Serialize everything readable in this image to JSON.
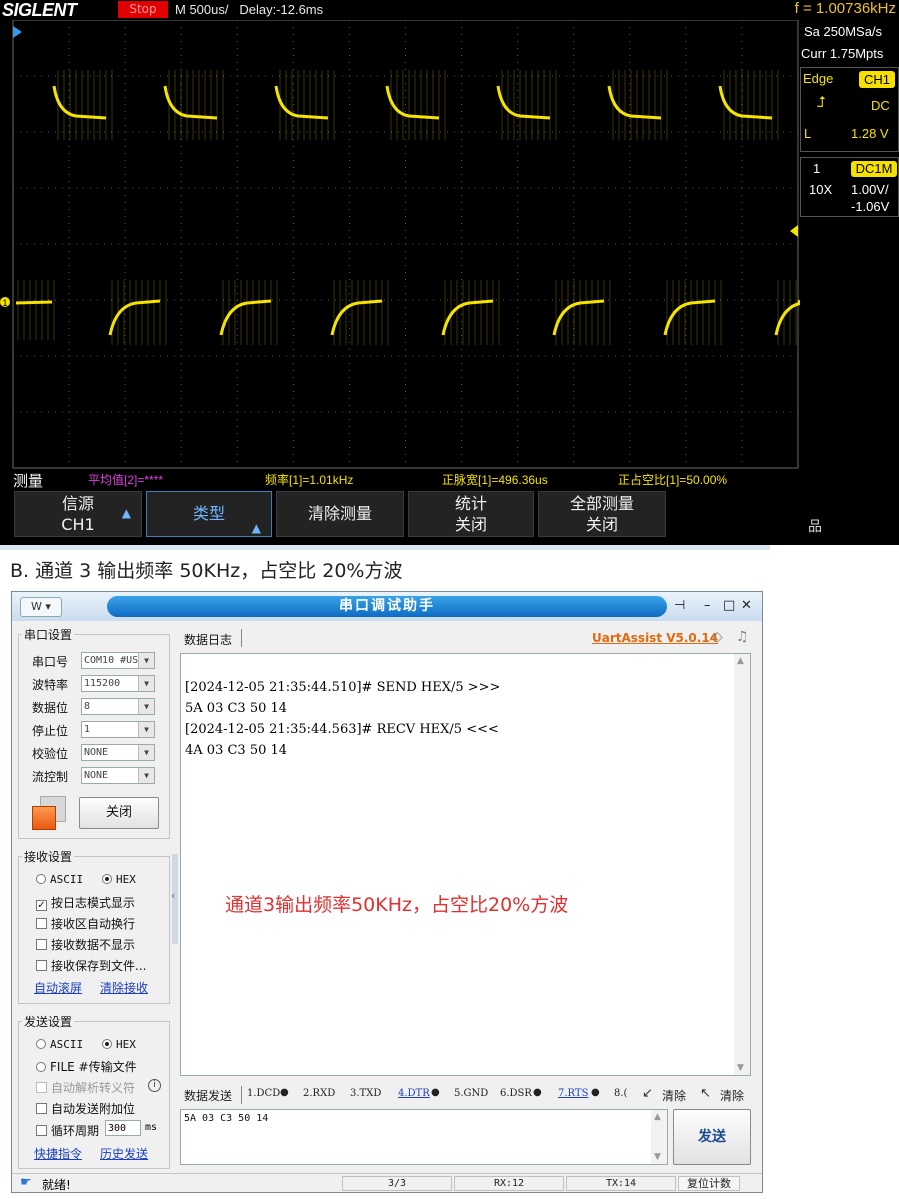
{
  "scope": {
    "brand": "SIGLENT",
    "run_state": "Stop",
    "timebase": "M 500us/",
    "delay": "Delay:-12.6ms",
    "frequency": "f = 1.00736kHz",
    "sample_rate": "Sa 250MSa/s",
    "memory": "Curr 1.75Mpts",
    "trigger": {
      "mode": "Edge",
      "source": "CH1",
      "slope_icon": "rising-edge-icon",
      "coupling": "DC",
      "level_label": "L",
      "level": "1.28 V"
    },
    "channel": {
      "number": "1",
      "coupling_impedance": "DC1M",
      "probe": "10X",
      "scale": "1.00V/",
      "offset": "-1.06V"
    },
    "channel_marker": "1",
    "trace_color": "#f5e300",
    "measurements": {
      "label": "测量",
      "items": [
        {
          "text": "平均值[2]=****",
          "color": "#e040e0"
        },
        {
          "text": "频率[1]=1.01kHz",
          "color": "#f5e300"
        },
        {
          "text": "正脉宽[1]=496.36us",
          "color": "#f5e300"
        },
        {
          "text": "正占空比[1]=50.00%",
          "color": "#f5e300"
        }
      ]
    },
    "menu": [
      {
        "line1": "信源",
        "line2": "CH1"
      },
      {
        "line1": "类型",
        "line2": ""
      },
      {
        "line1": "清除测量",
        "line2": ""
      },
      {
        "line1": "统计",
        "line2": "关闭"
      },
      {
        "line1": "全部测量",
        "line2": "关闭"
      }
    ],
    "network_icon": "network-icon"
  },
  "caption": "B.  通道 3 输出频率 50KHz，占空比 20%方波",
  "app": {
    "title": "串口调试助手",
    "version_link": "UartAssist V5.0.14",
    "serial_settings": {
      "title": "串口设置",
      "fields": [
        {
          "label": "串口号",
          "value": "COM10 #US"
        },
        {
          "label": "波特率",
          "value": "115200"
        },
        {
          "label": "数据位",
          "value": "8"
        },
        {
          "label": "停止位",
          "value": "1"
        },
        {
          "label": "校验位",
          "value": "NONE"
        },
        {
          "label": "流控制",
          "value": "NONE"
        }
      ],
      "close_button": "关闭"
    },
    "receive_settings": {
      "title": "接收设置",
      "mode_ascii": "ASCII",
      "mode_hex": "HEX",
      "selected_mode": "HEX",
      "options": [
        {
          "label": "按日志模式显示",
          "checked": true
        },
        {
          "label": "接收区自动换行",
          "checked": false
        },
        {
          "label": "接收数据不显示",
          "checked": false
        },
        {
          "label": "接收保存到文件...",
          "checked": false
        }
      ],
      "link_auto_scroll": "自动滚屏",
      "link_clear": "清除接收"
    },
    "send_settings": {
      "title": "发送设置",
      "mode_ascii": "ASCII",
      "mode_hex": "HEX",
      "selected_mode": "HEX",
      "file_option": "FILE #传输文件",
      "options": [
        {
          "label": "自动解析转义符",
          "checked": false,
          "disabled": true
        },
        {
          "label": "自动发送附加位",
          "checked": false,
          "disabled": false
        }
      ],
      "cycle_label": "循环周期",
      "cycle_value": "300",
      "cycle_unit": "ms",
      "link_shortcut": "快捷指令",
      "link_history": "历史发送"
    },
    "log_tab": "数据日志",
    "log_lines": [
      {
        "text": "[2024-12-05 21:35:44.510]# SEND HEX/5 >>>",
        "color": "#8a8a8a"
      },
      {
        "text": "5A 03 C3 50 14",
        "color": "#1a2fa0"
      },
      {
        "text": "[2024-12-05 21:35:44.563]# RECV HEX/5 <<<",
        "color": "#8a8a8a"
      },
      {
        "text": "4A 03 C3 50 14",
        "color": "#2a9a2a"
      }
    ],
    "overlay_text": "通道3输出频率50KHz，占空比20%方波",
    "send_tab": "数据发送",
    "signals": [
      "1.DCD",
      "2.RXD",
      "3.TXD",
      "4.DTR",
      "5.GND",
      "6.DSR",
      "7.RTS",
      "8.("
    ],
    "clear_label_1": "清除",
    "clear_label_2": "清除",
    "send_text": "5A 03 C3 50 14",
    "send_button": "发送",
    "status": {
      "ready": "就绪!",
      "count": "3/3",
      "rx": "RX:12",
      "tx": "TX:14",
      "reset": "复位计数"
    }
  }
}
